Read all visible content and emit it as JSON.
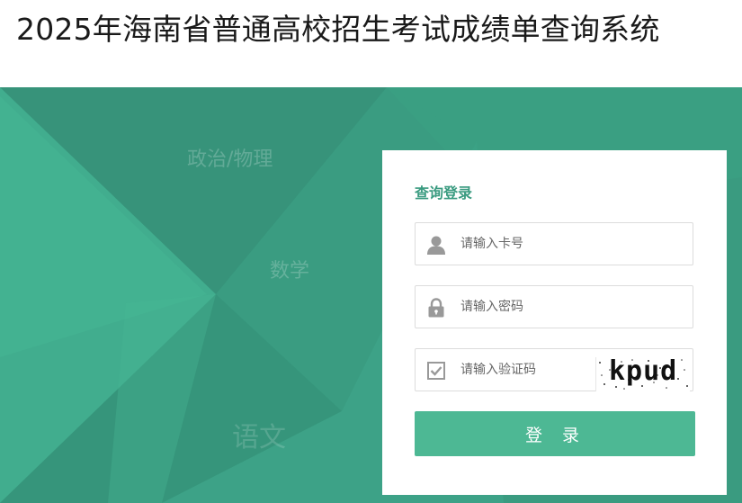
{
  "header": {
    "title": "2025年海南省普通高校招生考试成绩单查询系统"
  },
  "banner": {
    "subjects": [
      "政治/物理",
      "数学",
      "语文"
    ]
  },
  "login": {
    "title": "查询登录",
    "card_placeholder": "请输入卡号",
    "password_placeholder": "请输入密码",
    "captcha_placeholder": "请输入验证码",
    "captcha_text": "kpud",
    "submit_label": "登 录"
  },
  "colors": {
    "brand": "#3a9b80",
    "button": "#4db894",
    "icon": "#999999"
  },
  "icons": [
    "user-icon",
    "lock-icon",
    "checkbox-icon"
  ]
}
